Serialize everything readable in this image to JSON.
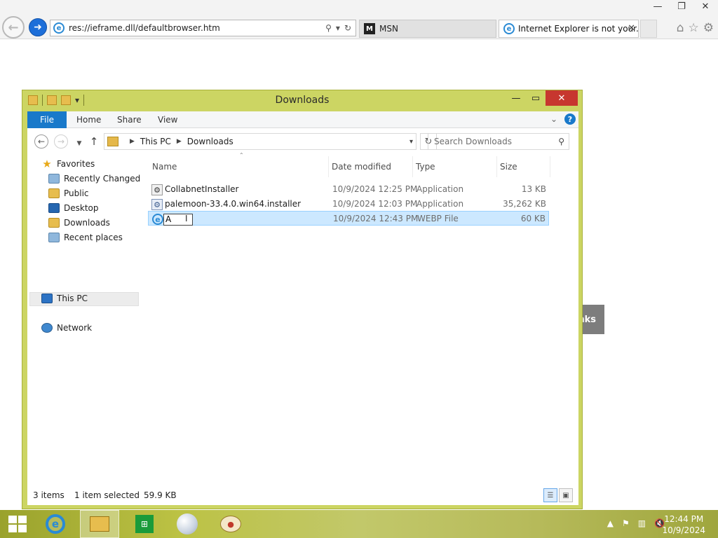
{
  "browser": {
    "address": "res://ieframe.dll/defaultbrowser.htm",
    "tabs": [
      {
        "label": "MSN"
      },
      {
        "label": "Internet Explorer is not your..."
      }
    ],
    "partial_button_text": "nks"
  },
  "explorer": {
    "title": "Downloads",
    "ribbon_tabs": [
      "File",
      "Home",
      "Share",
      "View"
    ],
    "breadcrumb": [
      "This PC",
      "Downloads"
    ],
    "search_placeholder": "Search Downloads",
    "nav": {
      "favorites": "Favorites",
      "items": [
        "Recently Changed",
        "Public",
        "Desktop",
        "Downloads",
        "Recent places"
      ],
      "this_pc": "This PC",
      "network": "Network"
    },
    "columns": [
      "Name",
      "Date modified",
      "Type",
      "Size"
    ],
    "files": [
      {
        "name": "CollabnetInstaller",
        "date": "10/9/2024 12:25 PM",
        "type": "Application",
        "size": "13 KB"
      },
      {
        "name": "palemoon-33.4.0.win64.installer",
        "date": "10/9/2024 12:03 PM",
        "type": "Application",
        "size": "35,262 KB"
      },
      {
        "name": "A",
        "date": "10/9/2024 12:43 PM",
        "type": "WEBP File",
        "size": "60 KB"
      }
    ],
    "status": {
      "count": "3 items",
      "selected": "1 item selected",
      "size": "59.9 KB"
    }
  },
  "taskbar": {
    "time": "12:44 PM",
    "date": "10/9/2024"
  }
}
